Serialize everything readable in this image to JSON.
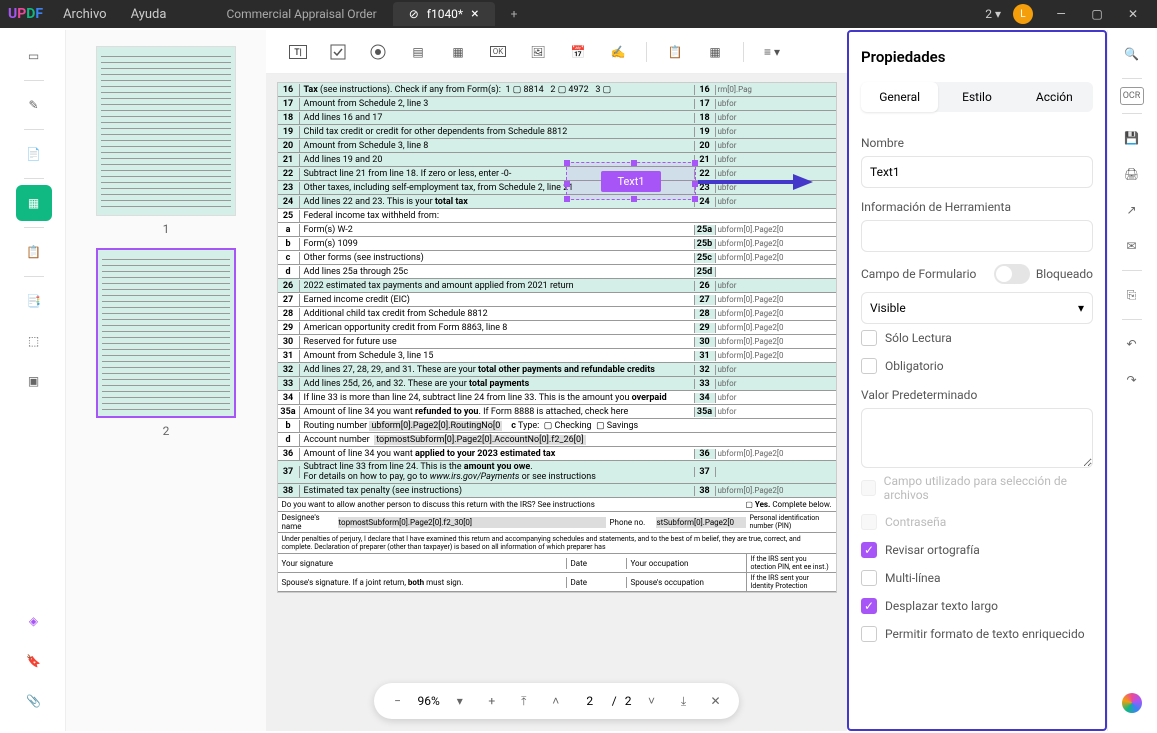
{
  "titlebar": {
    "menu_file": "Archivo",
    "menu_help": "Ayuda",
    "tab1": "Commercial Appraisal Order",
    "tab2": "f1040*",
    "version": "2",
    "avatar_letter": "L"
  },
  "thumbs": {
    "p1": "1",
    "p2": "2"
  },
  "form_lines": [
    {
      "n": "16",
      "t": "<b>Tax</b> (see instructions). Check if any from Form(s): &nbsp;1 ▢ 8814 &nbsp; 2 ▢ 4972 &nbsp; 3 ▢",
      "r": "16",
      "f": "rm[0].Pag"
    },
    {
      "n": "17",
      "t": "Amount from Schedule 2, line 3",
      "r": "17",
      "f": "ubfor"
    },
    {
      "n": "18",
      "t": "Add lines 16 and 17",
      "r": "18",
      "f": "ubfor"
    },
    {
      "n": "19",
      "t": "Child tax credit or credit for other dependents from Schedule 8812",
      "r": "19",
      "f": "ubfor"
    },
    {
      "n": "20",
      "t": "Amount from Schedule 3, line 8",
      "r": "20",
      "f": "ubfor"
    },
    {
      "n": "21",
      "t": "Add lines 19 and 20",
      "r": "21",
      "f": "ubfor"
    },
    {
      "n": "22",
      "t": "Subtract line 21 from line 18. If zero or less, enter -0-",
      "r": "22",
      "f": "ubfor"
    },
    {
      "n": "23",
      "t": "Other taxes, including self-employment tax, from Schedule 2, line 21",
      "r": "23",
      "f": "ubfor"
    },
    {
      "n": "24",
      "t": "Add lines 22 and 23. This is your <b>total tax</b>",
      "r": "24",
      "f": "ubfor"
    },
    {
      "n": "25",
      "t": "Federal income tax withheld from:",
      "r": "",
      "f": "",
      "w": true
    },
    {
      "n": "a",
      "t": "Form(s) W-2",
      "r": "25a",
      "f": "ubform[0].Page2[0",
      "w": true
    },
    {
      "n": "b",
      "t": "Form(s) 1099",
      "r": "25b",
      "f": "ubform[0].Page2[0",
      "w": true
    },
    {
      "n": "c",
      "t": "Other forms (see instructions)",
      "r": "25c",
      "f": "ubform[0].Page2[0",
      "w": true
    },
    {
      "n": "d",
      "t": "Add lines 25a through 25c",
      "r": "25d",
      "f": "",
      "w": true
    },
    {
      "n": "26",
      "t": "2022 estimated tax payments and amount applied from 2021 return",
      "r": "26",
      "f": "ubfor"
    },
    {
      "n": "27",
      "t": "Earned income credit (EIC)",
      "r": "27",
      "f": "ubform[0].Page2[0",
      "w": true
    },
    {
      "n": "28",
      "t": "Additional child tax credit from Schedule 8812",
      "r": "28",
      "f": "ubform[0].Page2[0",
      "w": true
    },
    {
      "n": "29",
      "t": "American opportunity credit from Form 8863, line 8",
      "r": "29",
      "f": "ubform[0].Page2[0",
      "w": true
    },
    {
      "n": "30",
      "t": "Reserved for future use",
      "r": "30",
      "f": "ubform[0].Page2[0",
      "w": true
    },
    {
      "n": "31",
      "t": "Amount from Schedule 3, line 15",
      "r": "31",
      "f": "ubform[0].Page2[0",
      "w": true
    },
    {
      "n": "32",
      "t": "Add lines 27, 28, 29, and 31. These are your <b>total other payments and refundable credits</b>",
      "r": "32",
      "f": "ubfor"
    },
    {
      "n": "33",
      "t": "Add lines 25d, 26, and 32. These are your <b>total payments</b>",
      "r": "33",
      "f": "ubfor"
    },
    {
      "n": "34",
      "t": "If line 33 is more than line 24, subtract line 24 from line 33. This is the amount you <b>overpaid</b>",
      "r": "34",
      "f": "ubfor",
      "w": true
    },
    {
      "n": "35a",
      "t": "Amount of line 34 you want <b>refunded to you</b>. If Form 8888 is attached, check here",
      "r": "35a",
      "f": "ubfor",
      "w": true
    },
    {
      "n": "b",
      "t": "Routing number <span style='background:#ddd;padding:0 2px'>ubform[0].Page2[0].RoutingNo[0</span> &nbsp;&nbsp; <b>c</b> Type: &nbsp;▢ Checking &nbsp;▢ Savings",
      "r": "",
      "f": "",
      "w": true
    },
    {
      "n": "d",
      "t": "Account number &nbsp;<span style='background:#ddd;padding:0 2px'>topmostSubform[0].Page2[0].AccountNo[0].f2_26[0]</span>",
      "r": "",
      "f": "",
      "w": true
    },
    {
      "n": "36",
      "t": "Amount of line 34 you want <b>applied to your 2023 estimated tax</b>",
      "r": "36",
      "f": "ubform[0].Page2[0",
      "w": true
    },
    {
      "n": "37",
      "t": "Subtract line 33 from line 24. This is the <b>amount you owe</b>.<br>For details on how to pay, go to <i>www.irs.gov/Payments</i> or see instructions",
      "r": "37",
      "f": ""
    },
    {
      "n": "38",
      "t": "Estimated tax penalty (see instructions)",
      "r": "38",
      "f": "ubform[0].Page2[0"
    }
  ],
  "form_extra": {
    "q": "Do you want to allow another person to discuss this return with the IRS? See instructions",
    "yes": "▢ <b>Yes.</b> Complete below.",
    "designee": "Designee's name",
    "designee_f": "topmostSubform[0].Page2[0].f2_30[0]",
    "phone": "Phone no.",
    "phone_f": "stSubform[0].Page2[0",
    "pin": "Personal identification number (PIN)",
    "perjury": "Under penalties of perjury, I declare that I have examined this return and accompanying schedules and statements, and to the best of m belief, they are true, correct, and complete. Declaration of preparer (other than taxpayer) is based on all information of which preparer has",
    "sig": "Your signature",
    "date": "Date",
    "occ": "Your occupation",
    "irs_sent": "If the IRS sent you otection PIN, ent ee inst.)",
    "spouse_sig": "Spouse's signature. If a joint return, <b>both</b> must sign.",
    "spouse_occ": "Spouse's occupation",
    "irs_sent2": "If the IRS sent your Identity Protection"
  },
  "field_label": "Text1",
  "pagectrl": {
    "zoom": "96%",
    "page": "2",
    "total": "2"
  },
  "props": {
    "title": "Propiedades",
    "tab_general": "General",
    "tab_style": "Estilo",
    "tab_action": "Acción",
    "name_label": "Nombre",
    "name_value": "Text1",
    "tooltip_label": "Información de Herramienta",
    "formfield_label": "Campo de Formulario",
    "locked_label": "Bloqueado",
    "visibility": "Visible",
    "readonly": "Sólo Lectura",
    "required": "Obligatorio",
    "default_label": "Valor Predeterminado",
    "chk_fileselect": "Campo utilizado para selección de archivos",
    "chk_password": "Contraseña",
    "chk_spellcheck": "Revisar ortografía",
    "chk_multiline": "Multi-línea",
    "chk_scroll": "Desplazar texto largo",
    "chk_richtext": "Permitir formato de texto enriquecido"
  }
}
